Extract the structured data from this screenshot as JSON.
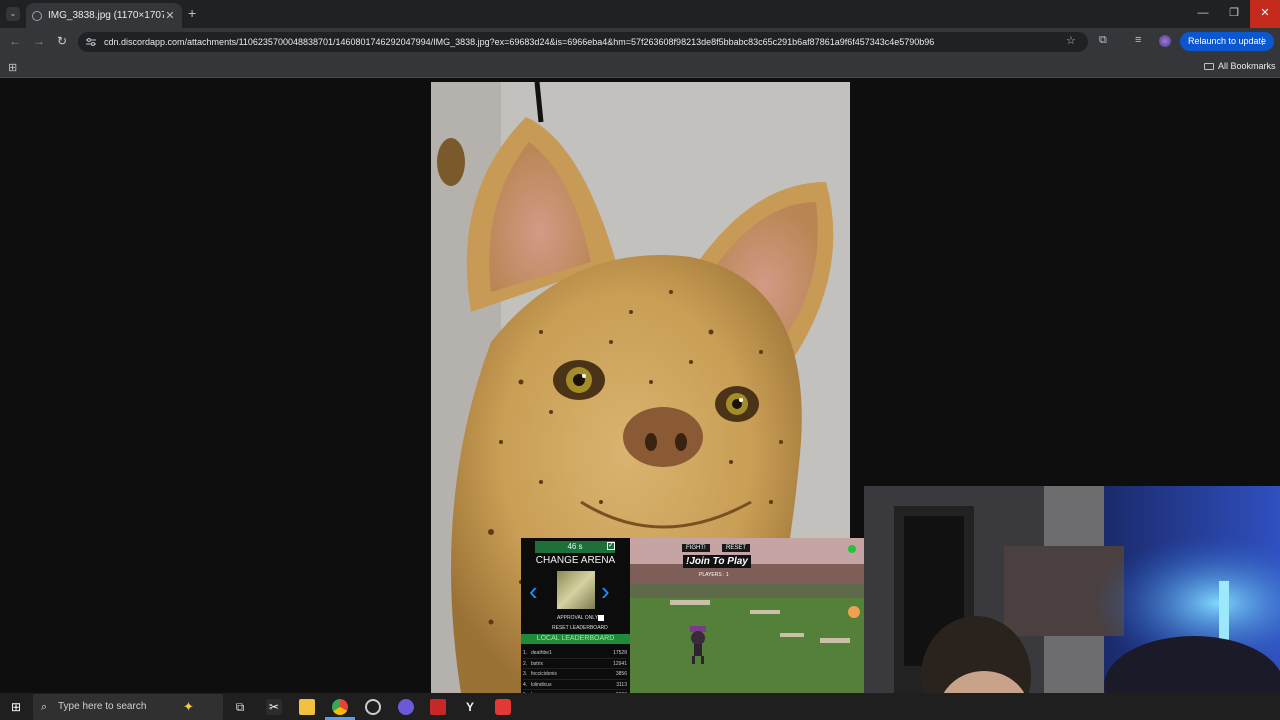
{
  "browser": {
    "tab": {
      "title": "IMG_3838.jpg (1170×1707)"
    },
    "url": "cdn.discordapp.com/attachments/1106235700048838701/1460801746292047994/IMG_3838.jpg?ex=69683d24&is=6966eba4&hm=57f263608f98213de8f5bbabc83c65c291b6af87861a9f6f457343c4e5790b96",
    "relaunch_label": "Relaunch to update",
    "bookmarks_label": "All Bookmarks"
  },
  "stream_overlay": {
    "timer": "46 s",
    "fight_label": "FIGHT!",
    "reset_label": "RESET",
    "change_arena_label": "CHANGE ARENA",
    "join_label": "!Join To Play",
    "players_label": "PLAYERS : 1",
    "approval_label": "APPROVAL ONLY",
    "reset_leaderboard_label": "RESET LEADERBOARD",
    "leaderboard_title": "LOCAL LEADERBOARD",
    "leaderboard": [
      {
        "rank": "1.",
        "name": "deathbe1",
        "score": "17528"
      },
      {
        "rank": "2.",
        "name": "bstrix",
        "score": "12941"
      },
      {
        "rank": "3.",
        "name": "foccicidonis",
        "score": "3856"
      },
      {
        "rank": "4.",
        "name": "lolindicus",
        "score": "3113"
      },
      {
        "rank": "5.",
        "name": "kcm",
        "score": "2006"
      },
      {
        "rank": "6.",
        "name": "lazbellas1221",
        "score": "2248"
      }
    ]
  },
  "taskbar": {
    "search_placeholder": "Type here to search"
  },
  "colors": {
    "accent_blue": "#0b57d0",
    "close_red": "#c42b1c",
    "leaderboard_green": "#1f8a3a",
    "arrow_blue": "#1e90ff"
  }
}
